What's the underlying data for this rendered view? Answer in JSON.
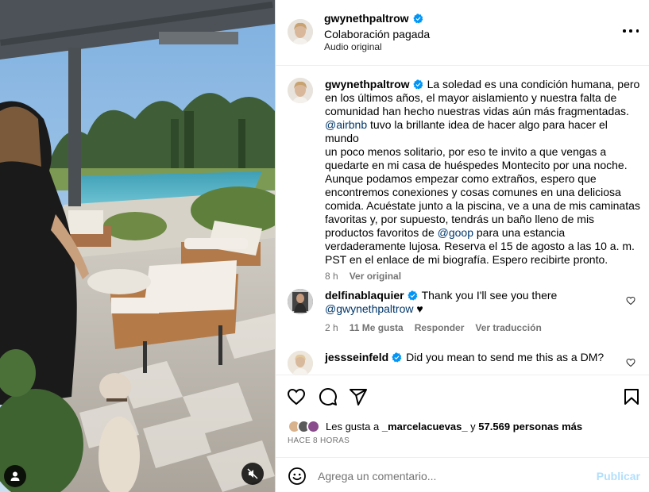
{
  "header": {
    "username": "gwynethpaltrow",
    "subtitle": "Colaboración pagada",
    "audio": "Audio original"
  },
  "caption": {
    "username": "gwynethpaltrow",
    "lines": [
      "La soledad es una condición humana, pero",
      "en los últimos años, el mayor aislamiento y nuestra falta de",
      "comunidad han hecho nuestras vidas aún más fragmentadas.",
      "",
      "tuvo la brillante idea de hacer algo para hacer el mundo",
      "un poco menos solitario, por eso te invito a que vengas a",
      "quedarte en mi casa de huéspedes Montecito por una noche.",
      "Aunque podamos empezar como extraños, espero que",
      "encontremos conexiones y cosas comunes en una deliciosa",
      "comida. Acuéstate junto a la piscina, ve a una de mis caminatas",
      "favoritas y, por supuesto, tendrás un baño lleno de mis",
      "productos favoritos de",
      "para una estancia",
      "verdaderamente lujosa. Reserva el 15 de agosto a las 10 a. m.",
      "PST en el enlace de mi biografía. Espero recibirte pronto."
    ],
    "mention_airbnb": "@airbnb",
    "mention_goop": "@goop",
    "age": "8 h",
    "see_original": "Ver original"
  },
  "comments": [
    {
      "username": "delfinablaquier",
      "text": "Thank you I'll see you there",
      "mention": "@gwynethpaltrow",
      "emoji": "♥",
      "age": "2 h",
      "likes": "11 Me gusta",
      "reply": "Responder",
      "translate": "Ver traducción"
    },
    {
      "username": "jessseinfeld",
      "text": "Did you mean to send me this as a DM?"
    }
  ],
  "likes": {
    "prefix": "Les gusta a",
    "user": "_marcelacuevas_",
    "and": "y",
    "count": "57.569 personas más"
  },
  "timestamp": "HACE 8 HORAS",
  "comment_box": {
    "placeholder": "Agrega un comentario...",
    "publish": "Publicar"
  },
  "colors": {
    "verified": "#0095f6",
    "link": "#00376b",
    "muted": "#737373",
    "publish_disabled": "#b2dffc"
  }
}
